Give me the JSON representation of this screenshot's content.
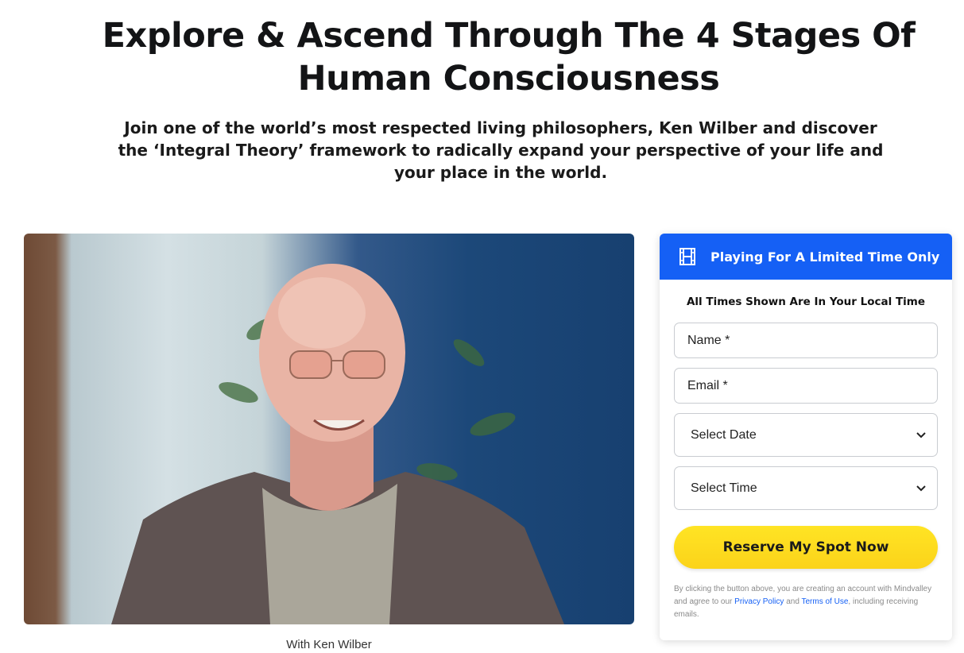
{
  "headline": {
    "line1": "Explore & Ascend Through The 4 Stages Of",
    "line2": "Human Consciousness"
  },
  "subheadline": {
    "line1": "Join one of the world’s most respected living philosophers, Ken Wilber and discover",
    "line2": "the ‘Integral Theory’ framework to radically expand your perspective of your life and",
    "line3": "your place in the world."
  },
  "hero": {
    "caption": "With Ken Wilber"
  },
  "form": {
    "header_icon": "film-icon",
    "header_label": "Playing For A Limited Time Only",
    "local_time_note": "All Times Shown Are In Your Local Time",
    "name_placeholder": "Name *",
    "email_placeholder": "Email *",
    "date_select": "Select Date",
    "time_select": "Select Time",
    "submit_label": "Reserve My Spot Now",
    "disclaimer_prefix": "By clicking the button above, you are creating an account with Mindvalley and agree to our",
    "privacy_link": "Privacy Policy",
    "and_text": "and",
    "terms_link": "Terms of Use",
    "disclaimer_suffix": "including receiving emails."
  },
  "colors": {
    "accent_blue": "#1560f5",
    "button_yellow": "#fbd31a"
  }
}
